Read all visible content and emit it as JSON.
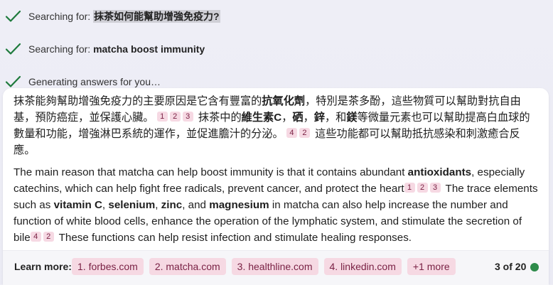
{
  "status": {
    "searching_label": "Searching for:",
    "query1": "抹茶如何能幫助增強免疫力?",
    "query2": "matcha boost immunity",
    "generating": "Generating answers for you…"
  },
  "answer": {
    "zh": {
      "s1": "抹茶能夠幫助增強免疫力的主要原因是它含有豐富的",
      "b1": "抗氧化劑",
      "s2": "，特別是茶多酚，這些物質可以幫助對抗自由基，預防癌症，並保護心臟。",
      "c1": "1",
      "c2": "2",
      "c3": "3",
      "s3": "抹茶中的",
      "b2": "維生素C",
      "s4": "，",
      "b3": "硒",
      "s5": "，",
      "b4": "鋅",
      "s6": "，和",
      "b5": "鎂",
      "s7": "等微量元素也可以幫助提高白血球的數量和功能，增強淋巴系統的運作，並促進膽汁的分泌。",
      "c4": "4",
      "c5": "2",
      "s8": "這些功能都可以幫助抵抗感染和刺激癒合反應。"
    },
    "en": {
      "s1": "The main reason that matcha can help boost immunity is that it contains abundant ",
      "b1": "antioxidants",
      "s2": ", especially catechins, which can help fight free radicals, prevent cancer, and protect the heart",
      "c1": "1",
      "c2": "2",
      "c3": "3",
      "s3": " The trace elements such as ",
      "b2": "vitamin C",
      "s4": ", ",
      "b3": "selenium",
      "s5": ", ",
      "b4": "zinc",
      "s6": ", and ",
      "b5": "magnesium",
      "s7": " in matcha can also help increase the number and function of white blood cells, enhance the operation of the lymphatic system, and stimulate the secretion of bile",
      "c4": "4",
      "c5": "2",
      "s8": " These functions can help resist infection and stimulate healing responses."
    }
  },
  "footer": {
    "learn_more": "Learn more:",
    "links": [
      "1. forbes.com",
      "2. matcha.com",
      "3. healthline.com",
      "4. linkedin.com",
      "+1 more"
    ],
    "count": "3 of 20",
    "status_color": "#2e8b4a"
  },
  "icons": {
    "status": "check-icon"
  }
}
